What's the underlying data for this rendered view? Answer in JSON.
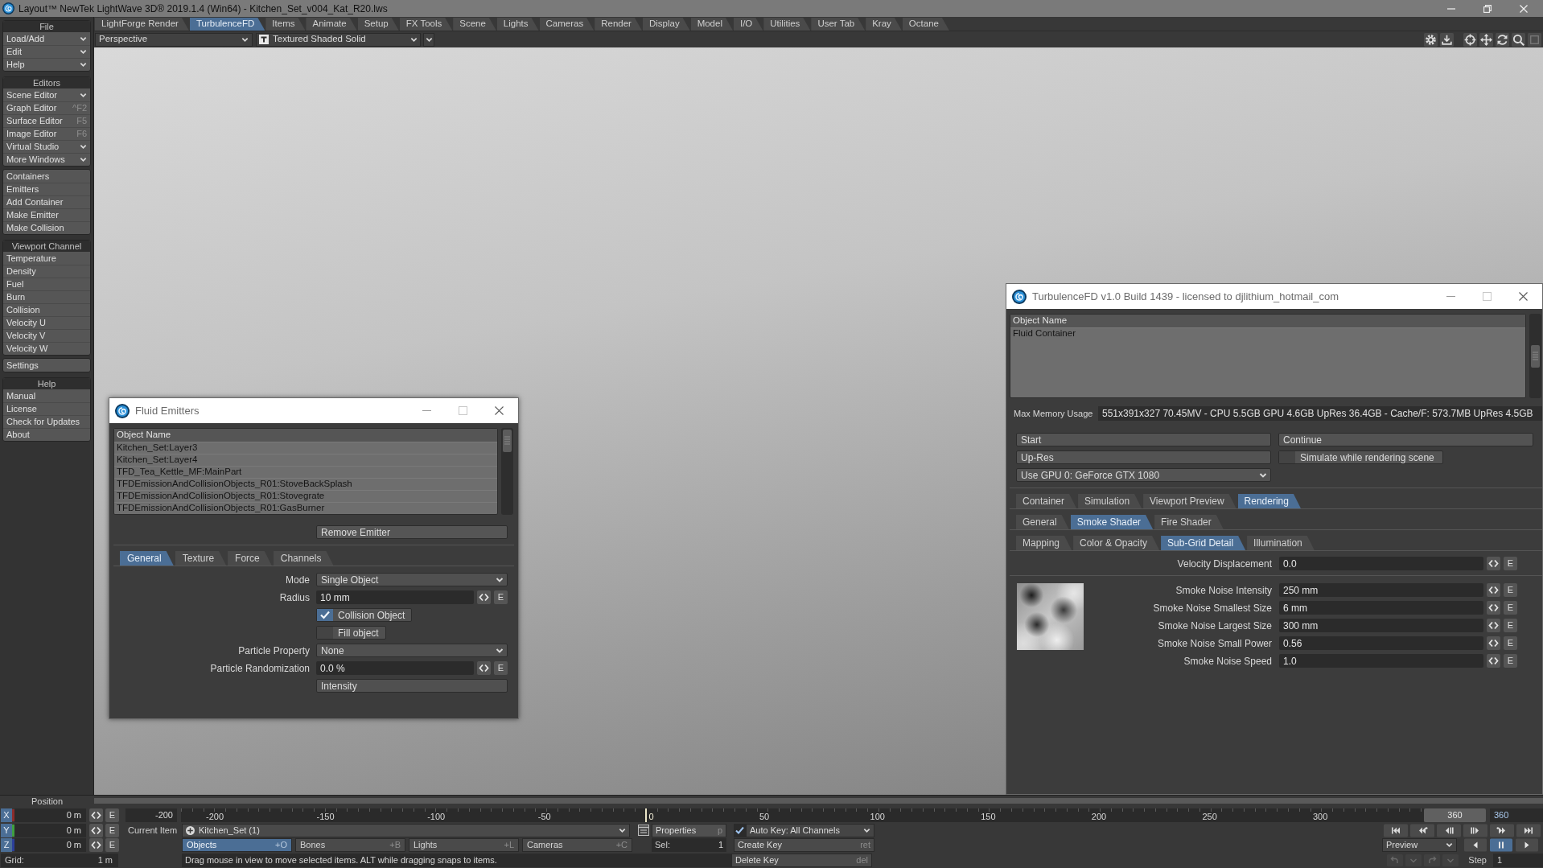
{
  "window": {
    "title": "Layout™ NewTek LightWave 3D® 2019.1.4 (Win64) - Kitchen_Set_v004_Kat_R20.lws"
  },
  "menu_tabs": [
    {
      "label": "LightForge Render",
      "selected": false
    },
    {
      "label": "TurbulenceFD",
      "selected": true
    },
    {
      "label": "Items",
      "selected": false
    },
    {
      "label": "Animate",
      "selected": false
    },
    {
      "label": "Setup",
      "selected": false
    },
    {
      "label": "FX Tools",
      "selected": false
    },
    {
      "label": "Scene",
      "selected": false
    },
    {
      "label": "Lights",
      "selected": false
    },
    {
      "label": "Cameras",
      "selected": false
    },
    {
      "label": "Render",
      "selected": false
    },
    {
      "label": "Display",
      "selected": false
    },
    {
      "label": "Model",
      "selected": false
    },
    {
      "label": "I/O",
      "selected": false
    },
    {
      "label": "Utilities",
      "selected": false
    },
    {
      "label": "User Tab",
      "selected": false
    },
    {
      "label": "Kray",
      "selected": false
    },
    {
      "label": "Octane",
      "selected": false
    }
  ],
  "viewport_bar": {
    "view": "Perspective",
    "shading": "Textured Shaded Solid"
  },
  "sidebar": {
    "groups": [
      {
        "header": "File",
        "items": [
          {
            "label": "Load/Add",
            "kind": "menu"
          },
          {
            "label": "Edit",
            "kind": "menu"
          },
          {
            "label": "Help",
            "kind": "menu"
          }
        ]
      },
      {
        "header": "Editors",
        "items": [
          {
            "label": "Scene Editor",
            "kind": "menu"
          },
          {
            "label": "Graph Editor",
            "kind": "command",
            "shortcut": "^F2"
          },
          {
            "label": "Surface Editor",
            "kind": "command",
            "shortcut": "F5"
          },
          {
            "label": "Image Editor",
            "kind": "command",
            "shortcut": "F6"
          },
          {
            "label": "Virtual Studio",
            "kind": "menu"
          },
          {
            "label": "More Windows",
            "kind": "menu"
          }
        ]
      },
      {
        "items": [
          {
            "label": "Containers",
            "kind": "command"
          },
          {
            "label": "Emitters",
            "kind": "command"
          },
          {
            "label": "Add Container",
            "kind": "command"
          },
          {
            "label": "Make Emitter",
            "kind": "command"
          },
          {
            "label": "Make Collision",
            "kind": "command"
          }
        ]
      },
      {
        "header": "Viewport Channel",
        "items": [
          {
            "label": "Temperature",
            "kind": "command"
          },
          {
            "label": "Density",
            "kind": "command"
          },
          {
            "label": "Fuel",
            "kind": "command"
          },
          {
            "label": "Burn",
            "kind": "command"
          },
          {
            "label": "Collision",
            "kind": "command"
          },
          {
            "label": "Velocity U",
            "kind": "command"
          },
          {
            "label": "Velocity V",
            "kind": "command"
          },
          {
            "label": "Velocity W",
            "kind": "command"
          }
        ]
      },
      {
        "items": [
          {
            "label": "Settings",
            "kind": "command"
          }
        ]
      },
      {
        "header": "Help",
        "items": [
          {
            "label": "Manual",
            "kind": "command"
          },
          {
            "label": "License",
            "kind": "command"
          },
          {
            "label": "Check for Updates",
            "kind": "command"
          },
          {
            "label": "About",
            "kind": "command"
          }
        ]
      }
    ]
  },
  "fluid_emitters": {
    "title": "Fluid Emitters",
    "list": {
      "header": "Object Name",
      "rows": [
        "Kitchen_Set:Layer3",
        "Kitchen_Set:Layer4",
        "TFD_Tea_Kettle_MF:MainPart",
        "TFDEmissionAndCollisionObjects_R01:StoveBackSplash",
        "TFDEmissionAndCollisionObjects_R01:Stovegrate",
        "TFDEmissionAndCollisionObjects_R01:GasBurner"
      ]
    },
    "remove_button": "Remove Emitter",
    "tabs": [
      {
        "label": "General",
        "selected": true
      },
      {
        "label": "Texture",
        "selected": false
      },
      {
        "label": "Force",
        "selected": false
      },
      {
        "label": "Channels",
        "selected": false
      }
    ],
    "fields": [
      {
        "kind": "dropdown",
        "label": "Mode",
        "value": "Single Object"
      },
      {
        "kind": "number",
        "label": "Radius",
        "value": "10 mm",
        "envelope": "E"
      },
      {
        "kind": "checkbox",
        "text": "Collision Object",
        "checked": true
      },
      {
        "kind": "checkbox",
        "text": "Fill object",
        "checked": false
      },
      {
        "kind": "dropdown",
        "label": "Particle Property",
        "value": "None"
      },
      {
        "kind": "number",
        "label": "Particle Randomization",
        "value": "0.0 %",
        "envelope": "E"
      },
      {
        "kind": "button",
        "text": "Intensity"
      }
    ]
  },
  "turbulencefd": {
    "title": "TurbulenceFD v1.0 Build 1439 - licensed to djlithium_hotmail_com",
    "list": {
      "header": "Object Name",
      "rows": [
        "Fluid Container"
      ]
    },
    "memory": {
      "label": "Max Memory Usage",
      "value": "551x391x327 70.45MV - CPU 5.5GB GPU 4.6GB UpRes 36.4GB - Cache/F: 573.7MB UpRes 4.5GB"
    },
    "controls": [
      {
        "kind": "button",
        "text": "Start"
      },
      {
        "kind": "button",
        "text": "Continue"
      },
      {
        "kind": "button",
        "text": "Up-Res"
      },
      {
        "kind": "checkbox",
        "text": "Simulate while rendering scene",
        "checked": false
      },
      {
        "kind": "dropdown",
        "text": "Use GPU 0: GeForce GTX 1080"
      }
    ],
    "tab_rows": [
      {
        "tabs": [
          {
            "label": "Container",
            "selected": false
          },
          {
            "label": "Simulation",
            "selected": false
          },
          {
            "label": "Viewport Preview",
            "selected": false
          },
          {
            "label": "Rendering",
            "selected": true
          }
        ]
      },
      {
        "tabs": [
          {
            "label": "General",
            "selected": false
          },
          {
            "label": "Smoke Shader",
            "selected": true
          },
          {
            "label": "Fire Shader",
            "selected": false
          }
        ]
      },
      {
        "tabs": [
          {
            "label": "Mapping",
            "selected": false
          },
          {
            "label": "Color & Opacity",
            "selected": false
          },
          {
            "label": "Sub-Grid Detail",
            "selected": true
          },
          {
            "label": "Illumination",
            "selected": false
          }
        ]
      }
    ],
    "velocity": {
      "label": "Velocity Displacement",
      "value": "0.0",
      "envelope": "E"
    },
    "noise_fields": [
      {
        "label": "Smoke Noise Intensity",
        "value": "250 mm",
        "envelope": "E"
      },
      {
        "label": "Smoke Noise Smallest Size",
        "value": "6 mm",
        "envelope": "E"
      },
      {
        "label": "Smoke Noise Largest Size",
        "value": "300 mm",
        "envelope": "E"
      },
      {
        "label": "Smoke Noise Small Power",
        "value": "0.56",
        "envelope": "E"
      },
      {
        "label": "Smoke Noise Speed",
        "value": "1.0",
        "envelope": "E"
      }
    ]
  },
  "bottom_panel": {
    "position_label": "Position",
    "axes": [
      {
        "axis": "X",
        "value": "0 m",
        "envelope": "E",
        "color": "#8c2c2c"
      },
      {
        "axis": "Y",
        "value": "0 m",
        "envelope": "E",
        "color": "#3fa03f"
      },
      {
        "axis": "Z",
        "value": "0 m",
        "envelope": "E",
        "color": "#2c3f9a"
      }
    ],
    "grid": {
      "label": "Grid:",
      "value": "1 m"
    },
    "timeline": {
      "start_frame": "-200",
      "ticks": [
        {
          "label": "-200",
          "key": false
        },
        {
          "label": "-150",
          "key": false
        },
        {
          "label": "-100",
          "key": false
        },
        {
          "label": "-50",
          "key": false
        },
        {
          "label": "0",
          "key": true
        },
        {
          "label": "50",
          "key": false
        },
        {
          "label": "100",
          "key": false
        },
        {
          "label": "150",
          "key": false
        },
        {
          "label": "200",
          "key": false
        },
        {
          "label": "250",
          "key": false
        },
        {
          "label": "300",
          "key": false
        }
      ],
      "current_frame": "360",
      "end_frame": "360"
    },
    "current_item": {
      "label": "Current Item",
      "value": "Kitchen_Set (1)"
    },
    "item_types": [
      {
        "label": "Objects",
        "shortcut": "+O",
        "selected": true
      },
      {
        "label": "Bones",
        "shortcut": "+B",
        "selected": false
      },
      {
        "label": "Lights",
        "shortcut": "+L",
        "selected": false
      },
      {
        "label": "Cameras",
        "shortcut": "+C",
        "selected": false
      }
    ],
    "status": "Drag mouse in view to move selected items. ALT while dragging snaps to items.",
    "properties": {
      "label": "Properties",
      "shortcut": "p"
    },
    "selection": {
      "label": "Sel:",
      "value": "1"
    },
    "auto_key": {
      "label": "Auto Key: All Channels",
      "checked": true
    },
    "key_buttons": [
      {
        "label": "Create Key",
        "shortcut": "ret"
      },
      {
        "label": "Delete Key",
        "shortcut": "del"
      }
    ],
    "preview": "Preview",
    "playback": [
      {
        "kind": "reverse",
        "selected": false
      },
      {
        "kind": "pause",
        "selected": true
      },
      {
        "kind": "play",
        "selected": false
      }
    ],
    "step": {
      "label": "Step",
      "value": "1"
    }
  }
}
